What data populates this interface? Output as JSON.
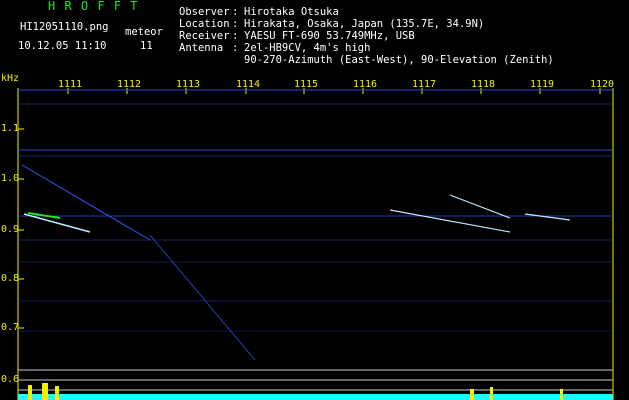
{
  "header": {
    "app_name": "H R O F F T",
    "filename": "HI12051110.png",
    "meteor_label": "meteor",
    "datetime": "10.12.05 11:10",
    "meteor_count": "11",
    "observer_label": "Observer",
    "observer_value": "Hirotaka Otsuka",
    "location_label": "Location",
    "location_value": "Hirakata, Osaka, Japan (135.7E, 34.9N)",
    "receiver_label": "Receiver",
    "receiver_value": "YAESU FT-690 53.749MHz, USB",
    "antenna_label": "Antenna",
    "antenna_value": "2el-HB9CV, 4m's high",
    "antenna_value2": "90-270-Azimuth (East-West), 90-Elevation (Zenith)"
  },
  "y_unit": "kHz",
  "x_ticks": [
    "1111",
    "1112",
    "1113",
    "1114",
    "1115",
    "1116",
    "1117",
    "1118",
    "1119",
    "1120"
  ],
  "y_ticks": [
    "1.1",
    "1.0",
    "0.9",
    "0.8",
    "0.7",
    "0.6"
  ],
  "colors": {
    "text": "#f2f200",
    "title": "#19e619",
    "trace": "#3a52ff",
    "meteor": "#bfe8ff",
    "level": "#19ffff"
  }
}
